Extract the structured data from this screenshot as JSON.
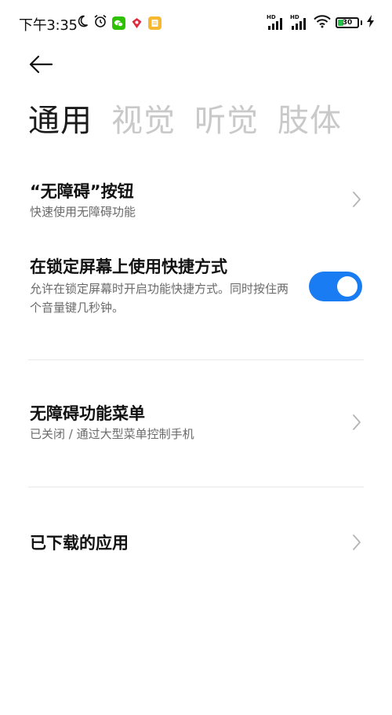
{
  "status_bar": {
    "time": "下午3:35",
    "battery": "30",
    "signal_label_1": "HD",
    "signal_label_2": "HD",
    "icons": [
      "moon-icon",
      "alarm-icon",
      "wechat-icon",
      "app-red-icon",
      "app-yellow-icon",
      "signal-icon",
      "wifi-icon",
      "battery-icon",
      "charging-icon"
    ]
  },
  "tabs": [
    {
      "label": "通用",
      "active": true
    },
    {
      "label": "视觉",
      "active": false
    },
    {
      "label": "听觉",
      "active": false
    },
    {
      "label": "肢体",
      "active": false
    }
  ],
  "rows": {
    "button": {
      "title": "“无障碍”按钮",
      "subtitle": "快速使用无障碍功能"
    },
    "lockscreen": {
      "title": "在锁定屏幕上使用快捷方式",
      "subtitle": "允许在锁定屏幕时开启功能快捷方式。同时按住两个音量键几秒钟。",
      "toggle_on": true
    },
    "menu": {
      "title": "无障碍功能菜单",
      "subtitle": "已关闭 / 通过大型菜单控制手机"
    },
    "downloaded": {
      "title": "已下载的应用"
    }
  },
  "colors": {
    "accent": "#1a7cf2",
    "tab_inactive": "#c9c9c9",
    "subtitle": "#6b6b6b"
  }
}
